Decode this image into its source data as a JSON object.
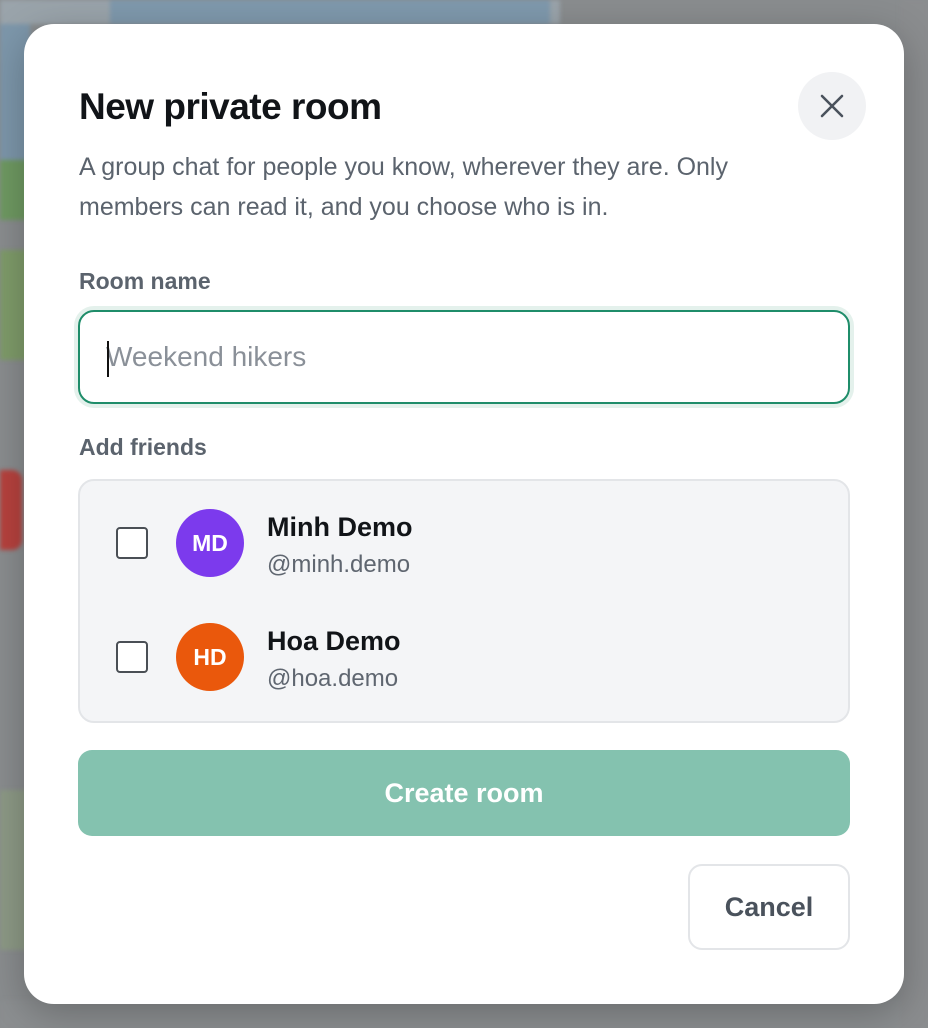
{
  "dialog": {
    "title": "New private room",
    "description": "A group chat for people you know, wherever they are. Only members can read it, and you choose who is in."
  },
  "room_name": {
    "label": "Room name",
    "placeholder": "Weekend hikers",
    "value": ""
  },
  "friends": {
    "label": "Add friends",
    "items": [
      {
        "initials": "MD",
        "name": "Minh Demo",
        "handle": "@minh.demo",
        "avatar_color": "#7c3aed",
        "checked": false
      },
      {
        "initials": "HD",
        "name": "Hoa Demo",
        "handle": "@hoa.demo",
        "avatar_color": "#ea580c",
        "checked": false
      }
    ]
  },
  "actions": {
    "create_label": "Create room",
    "cancel_label": "Cancel",
    "close_icon": "close-icon"
  },
  "colors": {
    "accent": "#1f8d6a",
    "create_button_disabled": "#84c2af"
  }
}
